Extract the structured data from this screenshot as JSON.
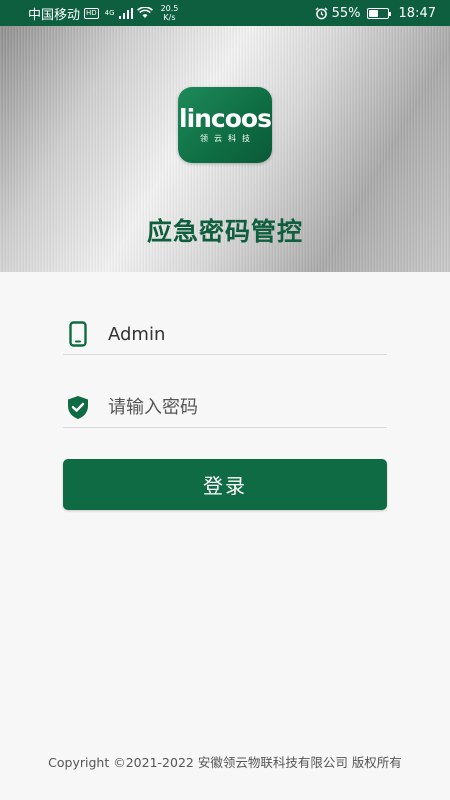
{
  "status_bar": {
    "carrier": "中国移动",
    "hd_badge": "HD",
    "network": "4G",
    "net_speed_value": "20.5",
    "net_speed_unit": "K/s",
    "battery_percent": "55%",
    "battery_level": 0.55,
    "time": "18:47"
  },
  "header": {
    "logo_word": "lincoos",
    "logo_sub": "领云科技",
    "app_title": "应急密码管控"
  },
  "form": {
    "account_value": "Admin",
    "password_placeholder": "请输入密码",
    "login_label": "登录"
  },
  "footer": {
    "copyright": "Copyright ©2021-2022 安徽领云物联科技有限公司 版权所有"
  },
  "colors": {
    "brand_green": "#0f6b43",
    "status_bar": "#0d5f40"
  }
}
